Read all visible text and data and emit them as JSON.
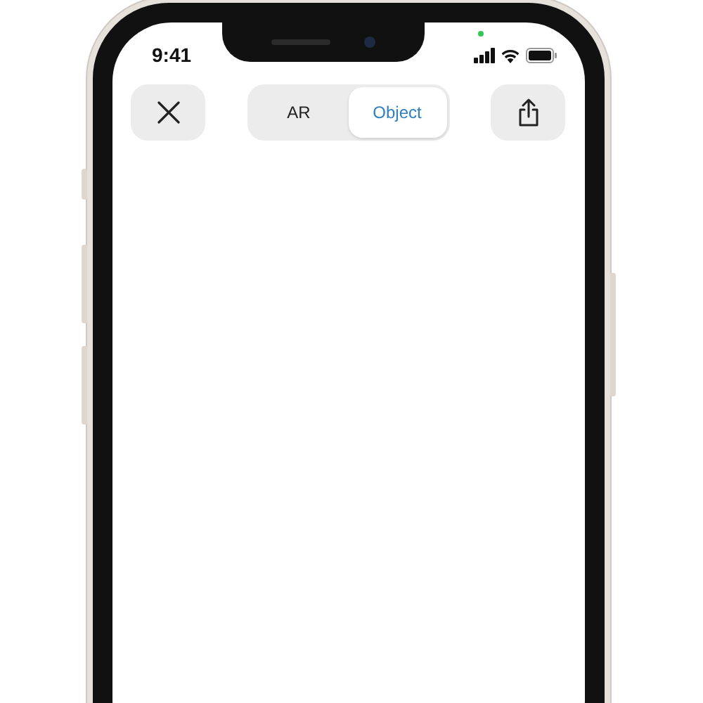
{
  "status_bar": {
    "time": "9:41",
    "camera_indicator": true
  },
  "tabs": [
    {
      "label": "AR",
      "selected": false
    },
    {
      "label": "Object",
      "selected": true
    }
  ]
}
